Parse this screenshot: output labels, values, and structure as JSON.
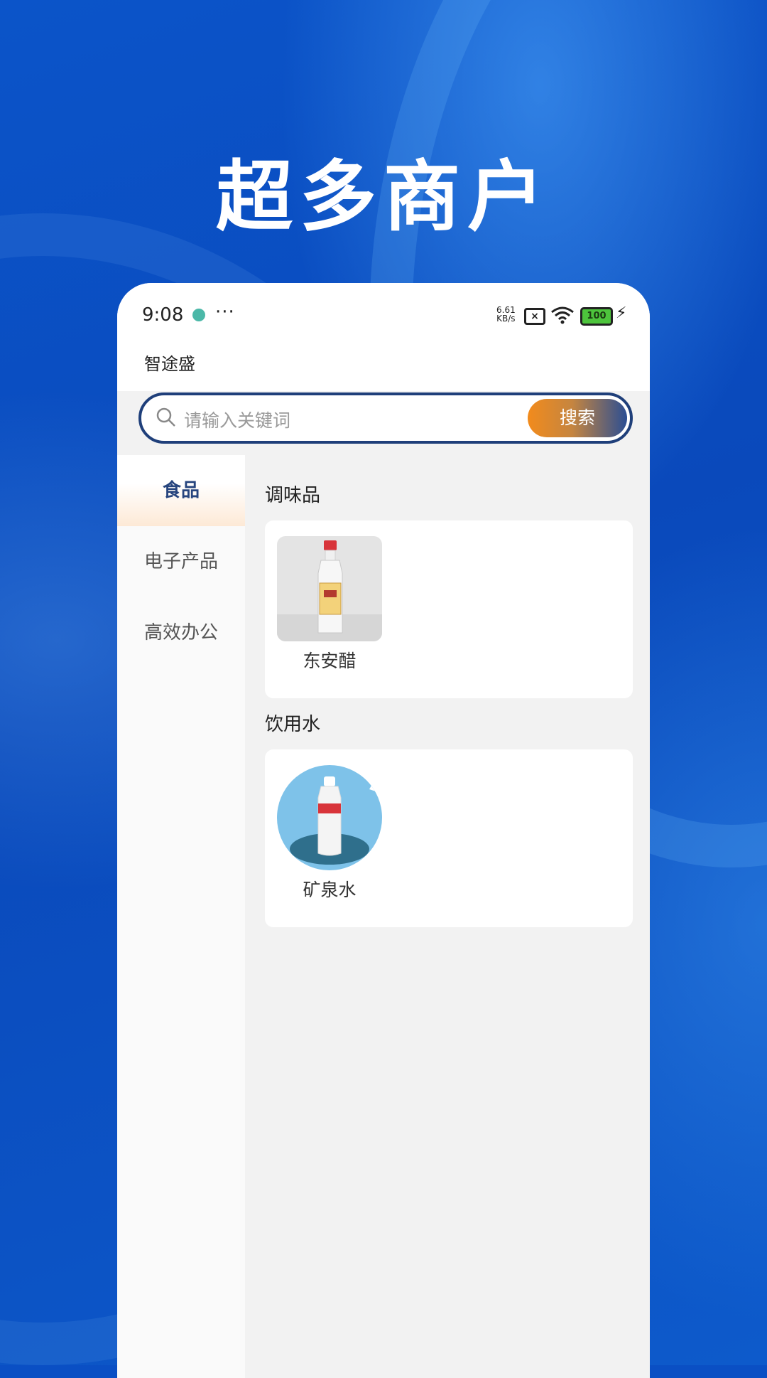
{
  "banner": {
    "headline": "超多商户"
  },
  "status_bar": {
    "time": "9:08",
    "more": "···",
    "net_speed_value": "6.61",
    "net_speed_unit": "KB/s",
    "battery": "100"
  },
  "app": {
    "title": "智途盛"
  },
  "search": {
    "placeholder": "请输入关键词",
    "button_label": "搜索"
  },
  "sidebar": {
    "items": [
      {
        "label": "食品",
        "active": true
      },
      {
        "label": "电子产品",
        "active": false
      },
      {
        "label": "高效办公",
        "active": false
      }
    ]
  },
  "sections": [
    {
      "title": "调味品",
      "products": [
        {
          "name": "东安醋",
          "icon": "vinegar-bottle-image"
        }
      ]
    },
    {
      "title": "饮用水",
      "products": [
        {
          "name": "矿泉水",
          "icon": "water-bottle-image"
        }
      ]
    }
  ],
  "colors": {
    "background_blue": "#0a4fc4",
    "active_category": "#27457e",
    "search_border": "#1f3f7a",
    "search_button_start": "#f28b1c",
    "search_button_end": "#2b4e93"
  }
}
